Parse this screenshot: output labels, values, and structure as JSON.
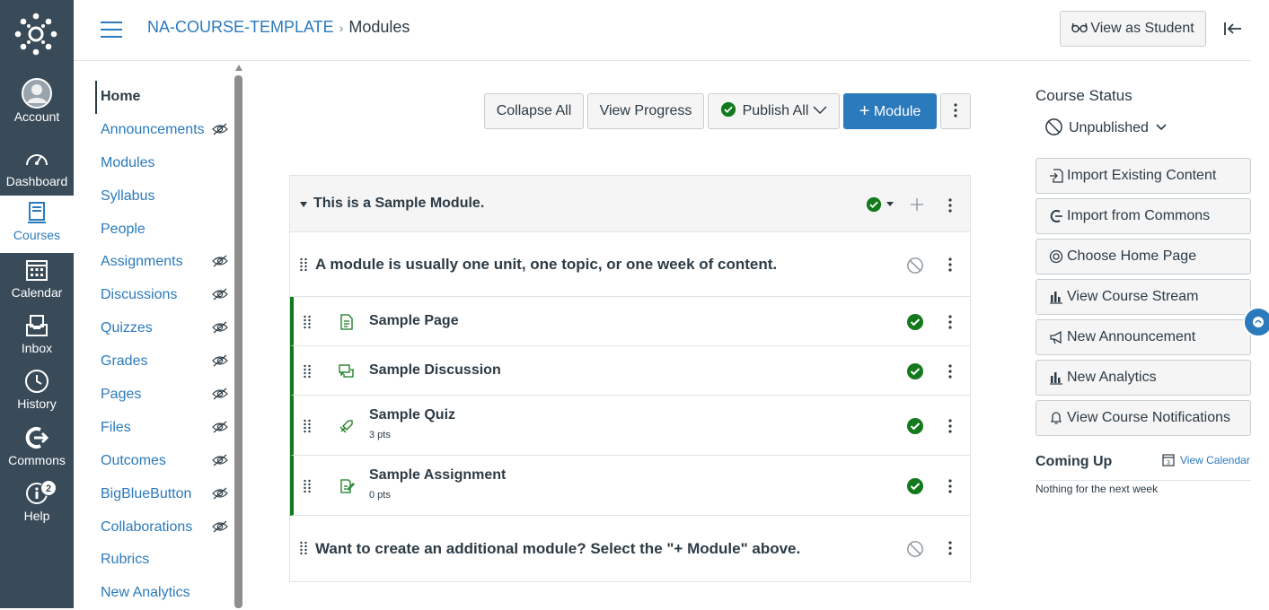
{
  "global_nav": {
    "items": [
      {
        "label": "Account",
        "icon": "account-avatar-icon"
      },
      {
        "label": "Dashboard",
        "icon": "dashboard-icon"
      },
      {
        "label": "Courses",
        "icon": "courses-icon",
        "active": true
      },
      {
        "label": "Calendar",
        "icon": "calendar-icon"
      },
      {
        "label": "Inbox",
        "icon": "inbox-icon"
      },
      {
        "label": "History",
        "icon": "history-icon"
      },
      {
        "label": "Commons",
        "icon": "commons-icon"
      },
      {
        "label": "Help",
        "icon": "help-icon",
        "badge": "2"
      }
    ]
  },
  "header": {
    "course": "NA-COURSE-TEMPLATE",
    "separator": "›",
    "page": "Modules",
    "view_as_student": "View as Student"
  },
  "course_nav": {
    "items": [
      {
        "label": "Home",
        "active": true,
        "hidden": false
      },
      {
        "label": "Announcements",
        "hidden": true
      },
      {
        "label": "Modules",
        "hidden": false
      },
      {
        "label": "Syllabus",
        "hidden": false
      },
      {
        "label": "People",
        "hidden": false
      },
      {
        "label": "Assignments",
        "hidden": true
      },
      {
        "label": "Discussions",
        "hidden": true
      },
      {
        "label": "Quizzes",
        "hidden": true
      },
      {
        "label": "Grades",
        "hidden": true
      },
      {
        "label": "Pages",
        "hidden": true
      },
      {
        "label": "Files",
        "hidden": true
      },
      {
        "label": "Outcomes",
        "hidden": true
      },
      {
        "label": "BigBlueButton",
        "hidden": true
      },
      {
        "label": "Collaborations",
        "hidden": true
      },
      {
        "label": "Rubrics",
        "hidden": false
      },
      {
        "label": "New Analytics",
        "hidden": false
      }
    ]
  },
  "toolbar": {
    "collapse_all": "Collapse All",
    "view_progress": "View Progress",
    "publish_all": "Publish All",
    "add_module": "Module"
  },
  "module": {
    "title": "This is a Sample Module.",
    "header_text": "A module is usually one unit, one topic, or one week of content.",
    "items": [
      {
        "title": "Sample Page",
        "type": "page",
        "pts": ""
      },
      {
        "title": "Sample Discussion",
        "type": "discussion",
        "pts": ""
      },
      {
        "title": "Sample Quiz",
        "type": "quiz",
        "pts": "3 pts"
      },
      {
        "title": "Sample Assignment",
        "type": "assignment",
        "pts": "0 pts"
      }
    ],
    "footer_text": "Want to create an additional module? Select the \"+ Module\" above."
  },
  "sidebar": {
    "course_status": "Course Status",
    "unpublished": "Unpublished",
    "buttons": [
      {
        "label": "Import Existing Content",
        "icon": "import-icon"
      },
      {
        "label": "Import from Commons",
        "icon": "commons-icon"
      },
      {
        "label": "Choose Home Page",
        "icon": "target-icon"
      },
      {
        "label": "View Course Stream",
        "icon": "bar-chart-icon"
      },
      {
        "label": "New Announcement",
        "icon": "megaphone-icon"
      },
      {
        "label": "New Analytics",
        "icon": "bar-chart-icon"
      },
      {
        "label": "View Course Notifications",
        "icon": "bell-icon"
      }
    ],
    "coming_up": "Coming Up",
    "view_calendar": "View Calendar",
    "nothing": "Nothing for the next week"
  },
  "colors": {
    "nav_bg": "#394b58",
    "link": "#2b7abc",
    "published": "#127a1b"
  }
}
